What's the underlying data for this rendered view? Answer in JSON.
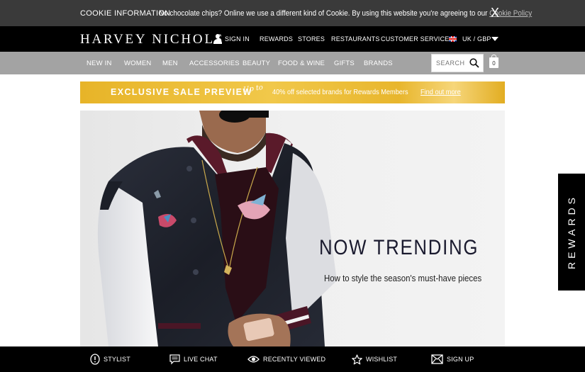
{
  "cookie": {
    "title": "COOKIE INFORMATION",
    "message": "No chocolate chips? Online we use a different kind of Cookie. By using this website you're agreeing to our",
    "policy_link": "Cookie Policy",
    "close": "X"
  },
  "header": {
    "logo": "HARVEY NICHOLS",
    "links": {
      "sign_in": "SIGN IN",
      "rewards": "REWARDS",
      "stores": "STORES",
      "restaurants": "RESTAURANTS",
      "customer_services": "CUSTOMER SERVICES"
    },
    "locale": "UK / GBP"
  },
  "categories": [
    "NEW IN",
    "WOMEN",
    "MEN",
    "ACCESSORIES",
    "BEAUTY",
    "FOOD & WINE",
    "GIFTS",
    "BRANDS"
  ],
  "search": {
    "placeholder": "SEARCH"
  },
  "bag": {
    "count": "0"
  },
  "promo": {
    "headline": "EXCLUSIVE SALE PREVIEW",
    "script": "Up to",
    "detail": "40% off selected brands for Rewards Members",
    "link": "Find out more"
  },
  "hero": {
    "title": "NOW TRENDING",
    "subtitle": "How to style the season's must-have pieces"
  },
  "rewards_tab": "REWARDS",
  "bottom_bar": {
    "stylist": "STYLIST",
    "live_chat": "LIVE CHAT",
    "recently_viewed": "RECENTLY VIEWED",
    "wishlist": "WISHLIST",
    "sign_up": "SIGN UP"
  },
  "colors": {
    "cookie_bg": "#3a3a3a",
    "nav_bg": "#000000",
    "category_bg": "#a3a3a3",
    "promo_gold": "#e9b62d",
    "hero_title": "#1a1a2e"
  }
}
